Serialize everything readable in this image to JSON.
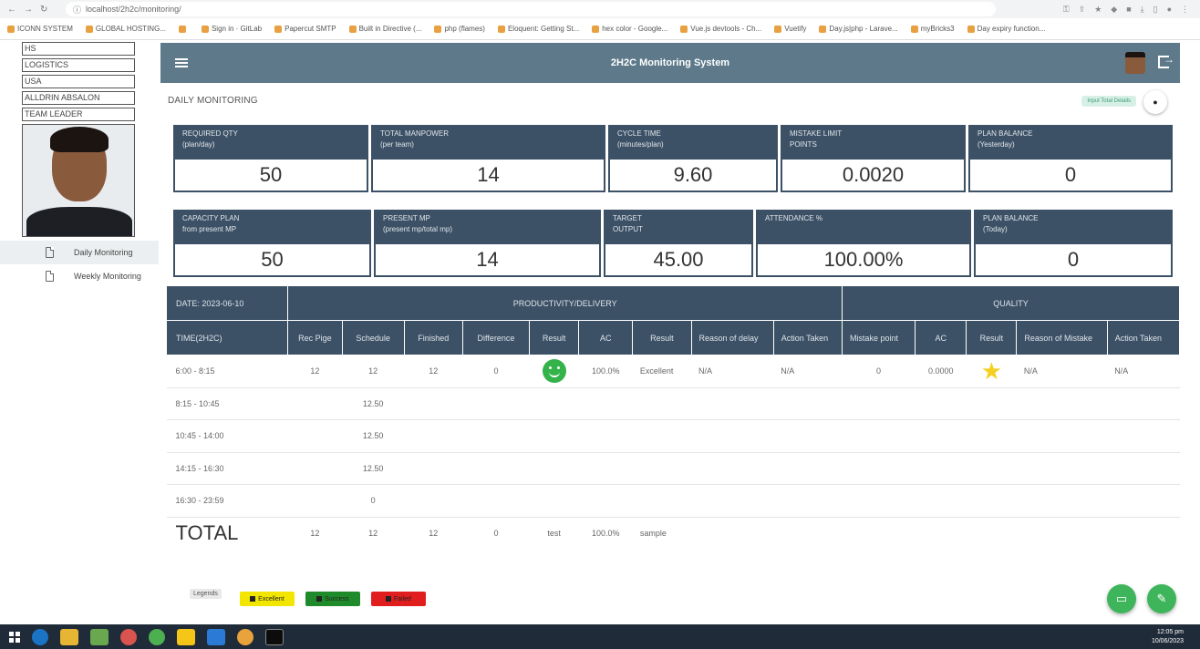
{
  "browser": {
    "url": "localhost/2h2c/monitoring/",
    "bookmarks": [
      "ICONN SYSTEM",
      "GLOBAL HOSTING...",
      "",
      "Sign in · GitLab",
      "Papercut SMTP",
      "Built in Directive (...",
      "php (flames)",
      "Eloquent: Getting St...",
      "hex color - Google...",
      "Vue.js devtools - Ch...",
      "Vuetify",
      "Day.js|php - Larave...",
      "myBricks3",
      "Day expiry function..."
    ]
  },
  "sidebar": {
    "info": [
      "HS",
      "LOGISTICS",
      "USA",
      "ALLDRIN ABSALON",
      "TEAM LEADER"
    ],
    "nav": [
      {
        "label": "Daily Monitoring",
        "icon": "document-icon"
      },
      {
        "label": "Weekly Monitoring",
        "icon": "document-icon"
      }
    ]
  },
  "header": {
    "title": "2H2C Monitoring System"
  },
  "page": {
    "title": "DAILY MONITORING",
    "input_button": "Input Total Details"
  },
  "kpi_row1": [
    {
      "label": "REQUIRED QTY",
      "sub": "(plan/day)",
      "value": "50"
    },
    {
      "label": "TOTAL MANPOWER",
      "sub": "(per team)",
      "value": "14"
    },
    {
      "label": "CYCLE TIME",
      "sub": "(minutes/plan)",
      "value": "9.60"
    },
    {
      "label": "MISTAKE LIMIT",
      "sub": "POINTS",
      "value": "0.0020"
    },
    {
      "label": "PLAN BALANCE",
      "sub": "(Yesterday)",
      "value": "0"
    }
  ],
  "kpi_row2": [
    {
      "label": "CAPACITY PLAN",
      "sub": "from present MP",
      "value": "50"
    },
    {
      "label": "PRESENT MP",
      "sub": "(present mp/total mp)",
      "value": "14"
    },
    {
      "label": "TARGET",
      "sub": "OUTPUT",
      "value": "45.00"
    },
    {
      "label": "ATTENDANCE %",
      "sub": "",
      "value": "100.00%"
    },
    {
      "label": "PLAN BALANCE",
      "sub": "(Today)",
      "value": "0"
    }
  ],
  "table": {
    "date_label": "DATE: 2023-06-10",
    "time_label": "TIME(2H2C)",
    "group1": "PRODUCTIVITY/DELIVERY",
    "group2": "QUALITY",
    "columns": [
      "Rec Pige",
      "Schedule",
      "Finished",
      "Difference",
      "Result",
      "AC",
      "Result",
      "Reason of delay",
      "Action Taken",
      "Mistake point",
      "AC",
      "Result",
      "Reason of Mistake",
      "Action Taken"
    ],
    "rows": [
      {
        "time": "6:00 - 8:15",
        "rec": "12",
        "schedule": "12",
        "finished": "12",
        "difference": "0",
        "result_icon": "smiley-icon",
        "ac": "100.0%",
        "result": "Excellent",
        "delay": "N/A",
        "action": "N/A",
        "mistake": "0",
        "q_ac": "0.0000",
        "q_result_icon": "star-icon",
        "reason": "N/A",
        "q_action": "N/A"
      },
      {
        "time": "8:15 - 10:45",
        "rec": "",
        "schedule": "12.50",
        "finished": "",
        "difference": "",
        "result_icon": "",
        "ac": "",
        "result": "",
        "delay": "",
        "action": "",
        "mistake": "",
        "q_ac": "",
        "q_result_icon": "",
        "reason": "",
        "q_action": ""
      },
      {
        "time": "10:45 - 14:00",
        "rec": "",
        "schedule": "12.50",
        "finished": "",
        "difference": "",
        "result_icon": "",
        "ac": "",
        "result": "",
        "delay": "",
        "action": "",
        "mistake": "",
        "q_ac": "",
        "q_result_icon": "",
        "reason": "",
        "q_action": ""
      },
      {
        "time": "14:15 - 16:30",
        "rec": "",
        "schedule": "12.50",
        "finished": "",
        "difference": "",
        "result_icon": "",
        "ac": "",
        "result": "",
        "delay": "",
        "action": "",
        "mistake": "",
        "q_ac": "",
        "q_result_icon": "",
        "reason": "",
        "q_action": ""
      },
      {
        "time": "16:30 - 23:59",
        "rec": "",
        "schedule": "0",
        "finished": "",
        "difference": "",
        "result_icon": "",
        "ac": "",
        "result": "",
        "delay": "",
        "action": "",
        "mistake": "",
        "q_ac": "",
        "q_result_icon": "",
        "reason": "",
        "q_action": ""
      }
    ],
    "total": {
      "label": "TOTAL",
      "rec": "12",
      "schedule": "12",
      "finished": "12",
      "difference": "0",
      "result": "test",
      "ac": "100.0%",
      "result2": "sample"
    }
  },
  "legend": {
    "title": "Legends",
    "items": [
      {
        "label": "Excellent",
        "color": "#f2e600"
      },
      {
        "label": "Success",
        "color": "#1f8a2a"
      },
      {
        "label": "Failed",
        "color": "#e01e1e"
      }
    ]
  },
  "taskbar": {
    "time": "12:05 pm",
    "date": "10/06/2023"
  },
  "colors": {
    "header": "#5e7a8a",
    "panel": "#3d5166",
    "fab": "#3eb55a"
  }
}
